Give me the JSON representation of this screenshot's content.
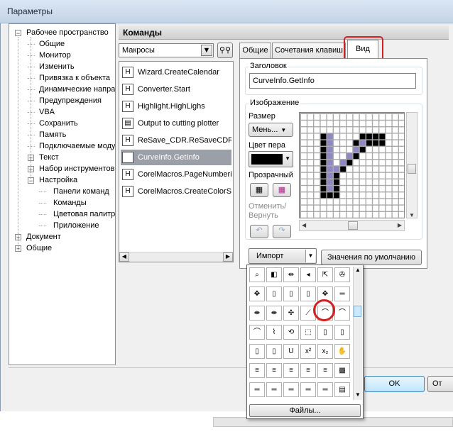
{
  "window": {
    "title": "Параметры"
  },
  "tree": {
    "items": [
      {
        "label": "Рабочее пространство",
        "level": 0,
        "toggle": "−"
      },
      {
        "label": "Общие",
        "level": 1
      },
      {
        "label": "Монитор",
        "level": 1
      },
      {
        "label": "Изменить",
        "level": 1
      },
      {
        "label": "Привязка к объекта",
        "level": 1
      },
      {
        "label": "Динамические напра",
        "level": 1
      },
      {
        "label": "Предупреждения",
        "level": 1
      },
      {
        "label": "VBA",
        "level": 1
      },
      {
        "label": "Сохранить",
        "level": 1
      },
      {
        "label": "Память",
        "level": 1
      },
      {
        "label": "Подключаемые моду",
        "level": 1
      },
      {
        "label": "Текст",
        "level": 1,
        "toggle": "+"
      },
      {
        "label": "Набор инструментов",
        "level": 1,
        "toggle": "+"
      },
      {
        "label": "Настройка",
        "level": 1,
        "toggle": "−"
      },
      {
        "label": "Панели команд",
        "level": 2
      },
      {
        "label": "Команды",
        "level": 2
      },
      {
        "label": "Цветовая палитр",
        "level": 2
      },
      {
        "label": "Приложение",
        "level": 2
      },
      {
        "label": "Документ",
        "level": 0,
        "toggle": "+"
      },
      {
        "label": "Общие",
        "level": 0,
        "toggle": "+"
      }
    ]
  },
  "commands": {
    "header": "Команды",
    "category": "Макросы",
    "items": [
      {
        "label": "Wizard.CreateCalendar",
        "icon": "H"
      },
      {
        "label": "Converter.Start",
        "icon": "H"
      },
      {
        "label": "Highlight.HighLighs",
        "icon": "H"
      },
      {
        "label": "Output to cutting plotter",
        "icon": "▤"
      },
      {
        "label": "ReSave_CDR.ReSaveCDR",
        "icon": "H"
      },
      {
        "label": "CurveInfo.GetInfo",
        "icon": "⌒"
      },
      {
        "label": "CorelMacros.PageNumbering",
        "icon": "H"
      },
      {
        "label": "CorelMacros.CreateColorSw",
        "icon": "H"
      }
    ],
    "selected_index": 5
  },
  "tabs": [
    {
      "label": "Общие"
    },
    {
      "label": "Сочетания клавиш"
    },
    {
      "label": "Вид"
    }
  ],
  "view": {
    "caption_group": "Заголовок",
    "caption_value": "CurveInfo.GetInfo",
    "image_group": "Изображение",
    "size_label": "Размер",
    "size_value": "Мень...",
    "pen_color_label": "Цвет пера",
    "transparent_label": "Прозрачный",
    "undo_redo_label": "Отменить/\nВернуть",
    "import_label": "Импорт",
    "defaults_button": "Значения по умолчанию"
  },
  "icon_picker": {
    "files_button": "Файлы...",
    "rows": [
      [
        "⌕",
        "◧",
        "⇹",
        "◂",
        "⇱",
        "✇"
      ],
      [
        "✥",
        "▯",
        "▯",
        "▯",
        "✥",
        "═"
      ],
      [
        "⇼",
        "⇼",
        "✣",
        "⟋",
        "⌒",
        "⌒"
      ],
      [
        "⌒",
        "⌇",
        "⟲",
        "⬚",
        "▯",
        "▯"
      ],
      [
        "▯",
        "▯",
        "U",
        "x²",
        "x₂",
        "✋"
      ],
      [
        "≡",
        "≡",
        "≡",
        "≡",
        "≡",
        "▩"
      ],
      [
        "═",
        "═",
        "═",
        "═",
        "═",
        "▤"
      ]
    ]
  },
  "footer": {
    "ok": "OK",
    "cancel": "От"
  },
  "colors": {
    "accent_red": "#d42020",
    "selection": "#9b9fa7"
  }
}
